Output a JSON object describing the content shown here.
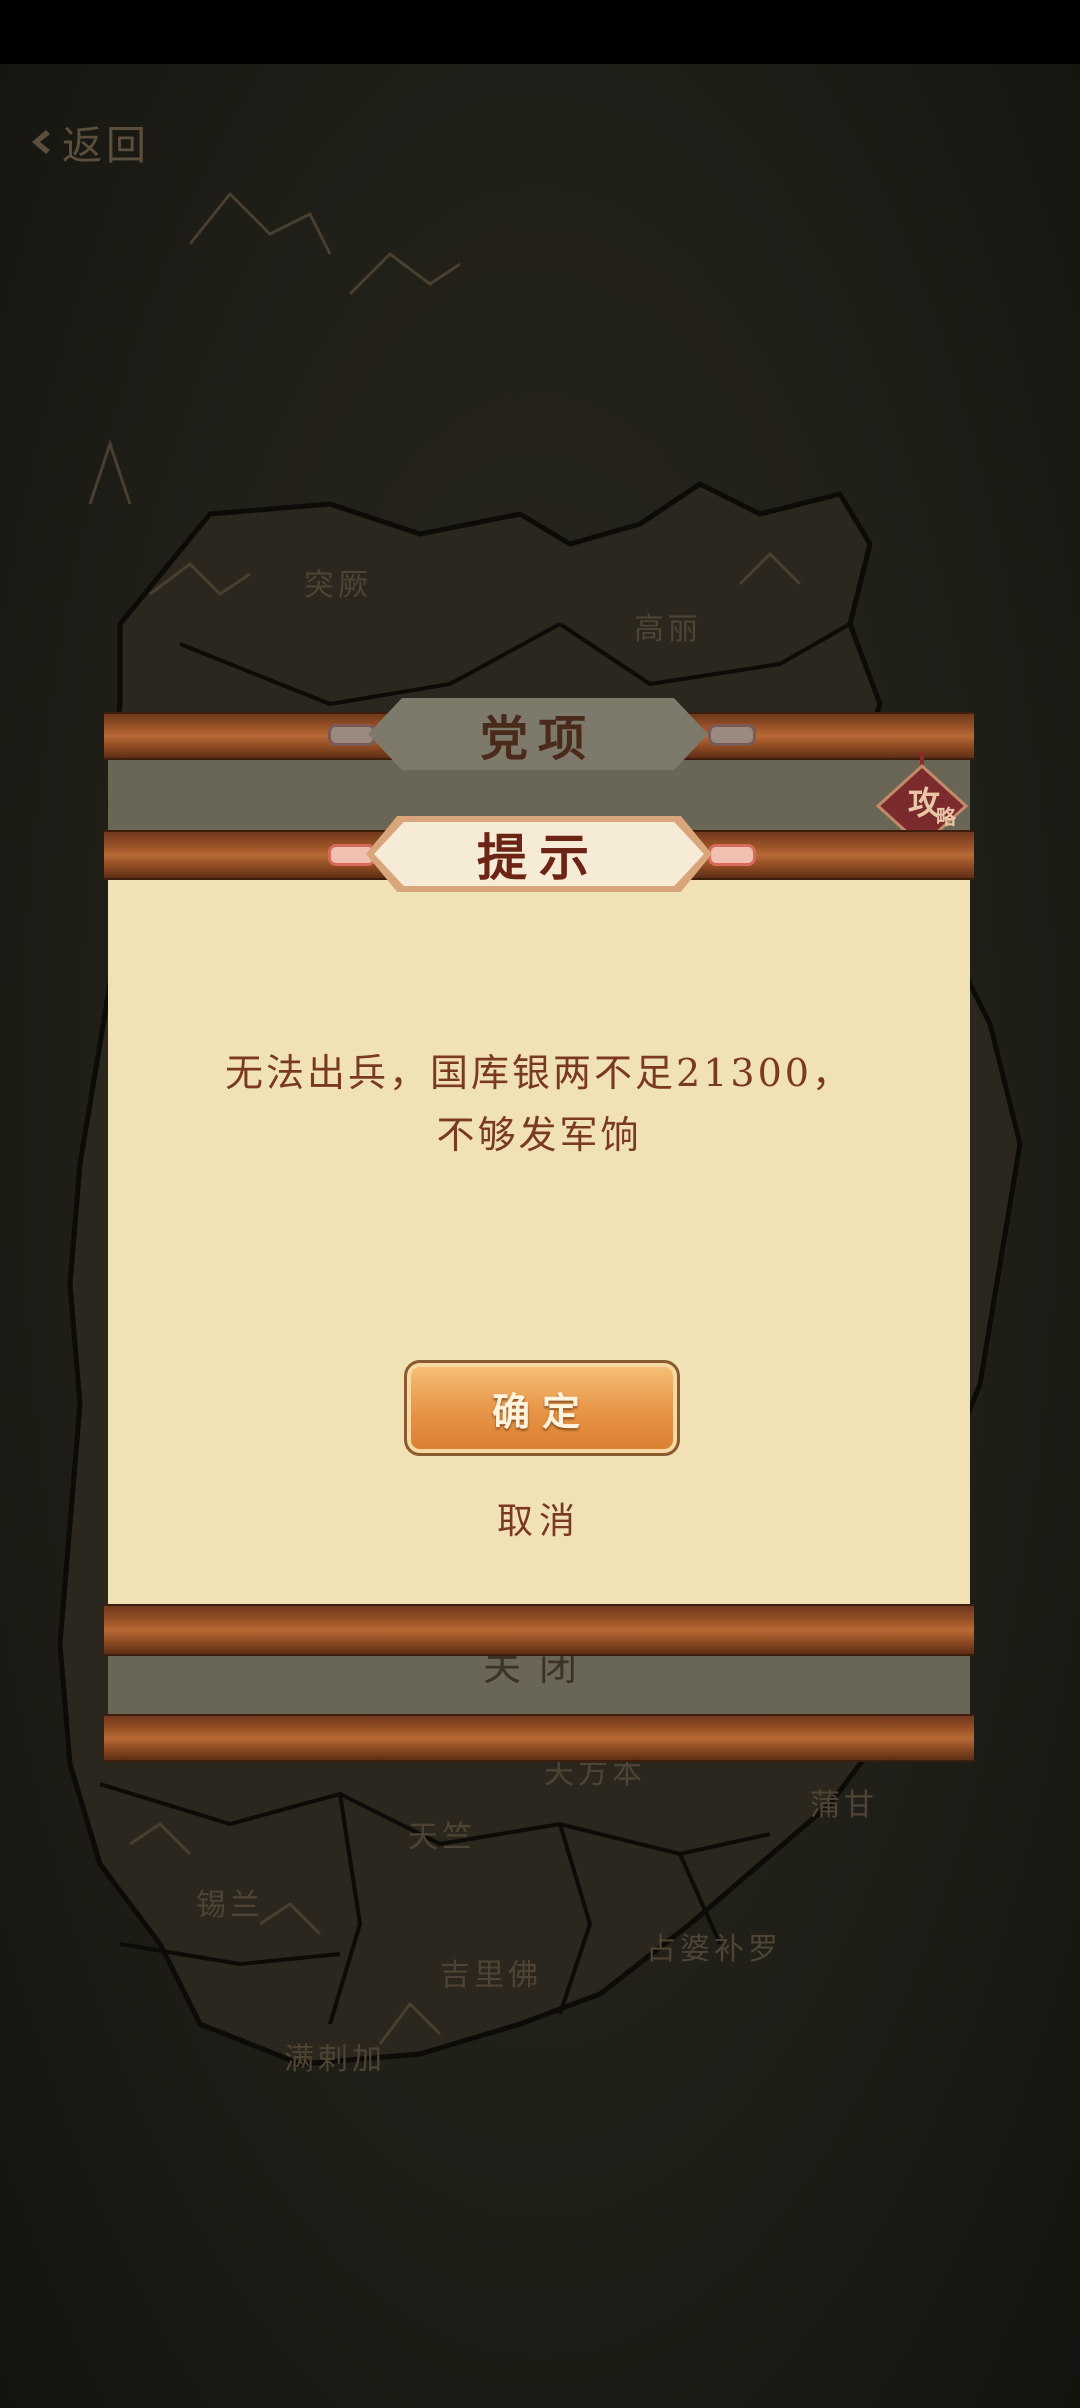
{
  "header": {
    "back_label": "返回"
  },
  "map_regions": [
    "突厥",
    "高丽",
    "天竺",
    "锡兰",
    "吉里佛",
    "占婆补罗",
    "蒲甘",
    "满剌加",
    "天方本"
  ],
  "background_panel": {
    "title": "党项",
    "close_label": "关闭",
    "strategy_badge": "攻略"
  },
  "dialog": {
    "title": "提示",
    "message_line1": "无法出兵，国库银两不足21300，",
    "message_line2": "不够发军饷",
    "confirm_label": "确定",
    "cancel_label": "取消"
  }
}
